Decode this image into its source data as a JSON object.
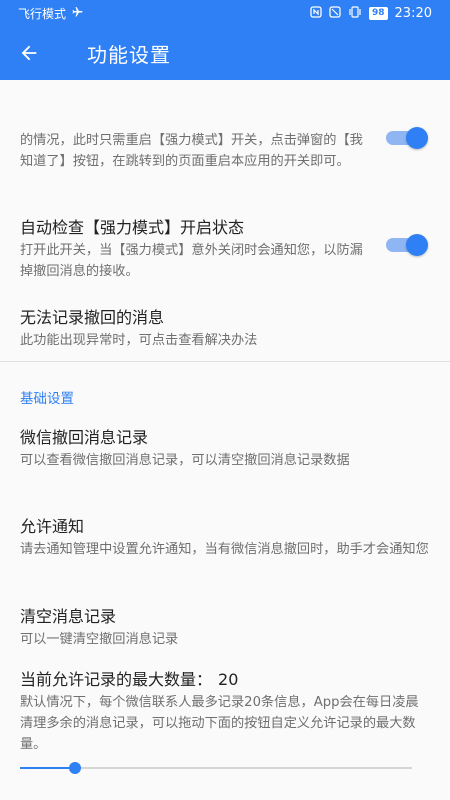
{
  "status_bar": {
    "mode_text": "飞行模式",
    "battery": "98",
    "time": "23:20"
  },
  "app_bar": {
    "title": "功能设置"
  },
  "settings": {
    "notice_continued": {
      "desc": "的情况，此时只需重启【强力模式】开关，点击弹窗的【我知道了】按钮，在跳转到的页面重启本应用的开关即可。",
      "switch_on": true
    },
    "auto_check": {
      "title": "自动检查【强力模式】开启状态",
      "desc": "打开此开关，当【强力模式】意外关闭时会通知您，以防漏掉撤回消息的接收。",
      "switch_on": true
    },
    "cannot_record": {
      "title": "无法记录撤回的消息",
      "desc": "此功能出现异常时，可点击查看解决办法"
    }
  },
  "basic_section": {
    "label": "基础设置",
    "records": {
      "title": "微信撤回消息记录",
      "desc": "可以查看微信撤回消息记录，可以清空撤回消息记录数据"
    },
    "allow_notify": {
      "title": "允许通知",
      "desc": "请去通知管理中设置允许通知，当有微信消息撤回时，助手才会通知您"
    },
    "clear_records": {
      "title": "清空消息记录",
      "desc": "可以一键清空撤回消息记录"
    },
    "max_count": {
      "title": "当前允许记录的最大数量：",
      "value": "20",
      "desc": "默认情况下，每个微信联系人最多记录20条信息，App会在每日凌晨清理多余的消息记录，可以拖动下面的按钮自定义允许记录的最大数量。",
      "slider_fraction": 0.14
    }
  },
  "colors": {
    "primary": "#2f80f5",
    "switch_track": "#8fb6f2"
  }
}
